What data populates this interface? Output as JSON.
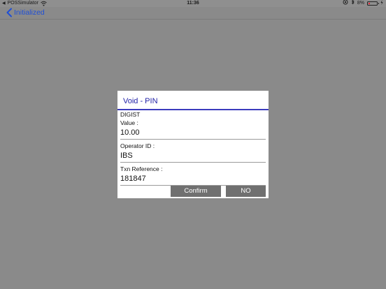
{
  "status_bar": {
    "app_name": "POSSimulator",
    "time": "11:36",
    "battery_percent": "8%",
    "battery_level": 0.08
  },
  "nav": {
    "back_label": "Initialized"
  },
  "dialog": {
    "title": "Void - PIN",
    "section_label": "DIGIST",
    "value_label": "Value :",
    "value": "10.00",
    "operator_label": "Operator ID :",
    "operator_value": "IBS",
    "txn_label": "Txn Reference :",
    "txn_value": "181847",
    "confirm_label": "Confirm",
    "no_label": "NO"
  },
  "colors": {
    "background": "#8a8a8a",
    "accent": "#1f4fd6",
    "dialog_title": "#2323a8",
    "button": "#707070"
  }
}
